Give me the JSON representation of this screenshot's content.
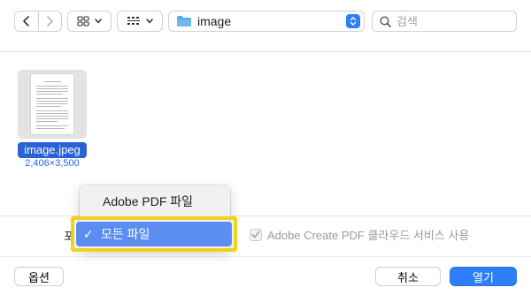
{
  "toolbar": {
    "back_icon": "chevron-left-icon",
    "forward_icon": "chevron-right-icon",
    "grid_view_icon": "grid-icon",
    "group_view_icon": "group-icon",
    "path_label": "image",
    "search_placeholder": "검색"
  },
  "files": [
    {
      "name": "image.jpeg",
      "meta": "2,406×3,500"
    }
  ],
  "options_row": {
    "format_label": "포",
    "cloud_checkbox_label": "Adobe Create PDF 클라우드 서비스 사용",
    "cloud_checkbox_checked": true
  },
  "popup": {
    "items": [
      {
        "label": "Adobe PDF 파일",
        "selected": false
      },
      {
        "label": "모든 파일",
        "selected": true
      }
    ],
    "check_mark": "✓"
  },
  "buttons": {
    "options": "옵션",
    "cancel": "취소",
    "open": "열기"
  },
  "colors": {
    "accent": "#2d7ff9",
    "selection": "#2a62d6",
    "highlight_box": "#f2d21a",
    "menu_selected": "#5b8ef0"
  }
}
